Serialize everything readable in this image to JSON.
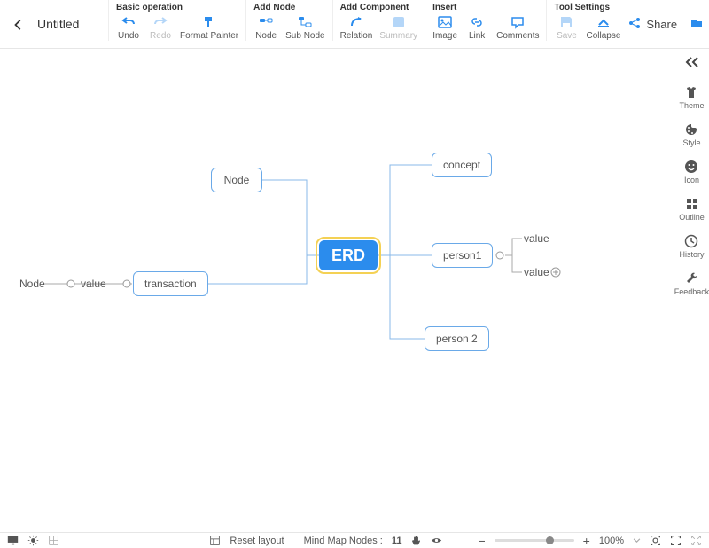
{
  "title": "Untitled",
  "toolbar": {
    "basic": {
      "title": "Basic operation",
      "undo": "Undo",
      "redo": "Redo",
      "format_painter": "Format Painter"
    },
    "add_node": {
      "title": "Add Node",
      "node": "Node",
      "sub_node": "Sub Node"
    },
    "add_component": {
      "title": "Add Component",
      "relation": "Relation",
      "summary": "Summary"
    },
    "insert": {
      "title": "Insert",
      "image": "Image",
      "link": "Link",
      "comments": "Comments"
    },
    "tool_settings": {
      "title": "Tool Settings",
      "save": "Save",
      "collapse": "Collapse"
    }
  },
  "actions": {
    "share": "Share",
    "export": "Export"
  },
  "side": {
    "theme": "Theme",
    "style": "Style",
    "icon": "Icon",
    "outline": "Outline",
    "history": "History",
    "feedback": "Feedback"
  },
  "diagram": {
    "root": "ERD",
    "node_box": "Node",
    "transaction": "transaction",
    "left_node": "Node",
    "left_value": "value",
    "concept": "concept",
    "person1": "person1",
    "person2": "person 2",
    "value1": "value",
    "value2": "value"
  },
  "bottom": {
    "reset": "Reset layout",
    "nodes_label": "Mind Map Nodes :",
    "nodes_count": "11",
    "zoom_pct": "100%"
  },
  "colors": {
    "accent": "#2b8ced"
  }
}
